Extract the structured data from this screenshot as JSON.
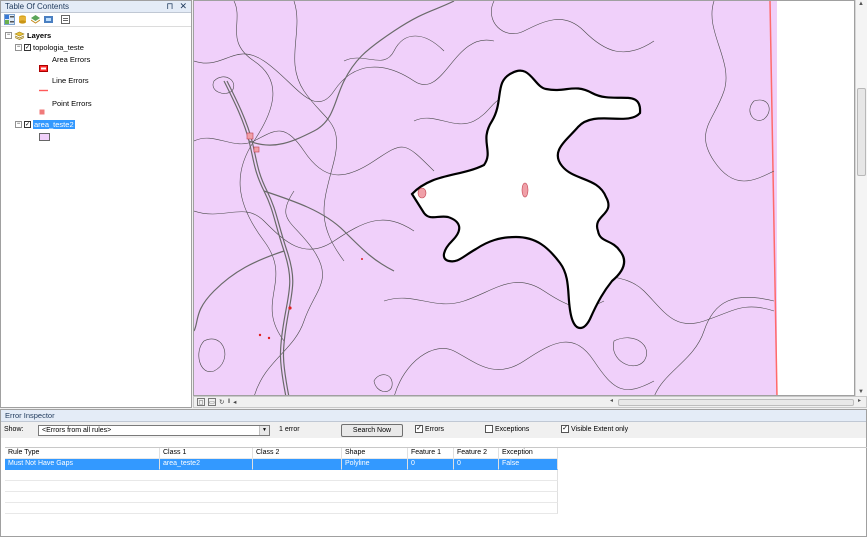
{
  "toc": {
    "title": "Table Of Contents",
    "pin": "⊓",
    "close": "✕",
    "layers_root": "Layers",
    "topology": "topologia_teste",
    "area_errors": "Area Errors",
    "line_errors": "Line Errors",
    "point_errors": "Point Errors",
    "area_layer": "area_teste2"
  },
  "error_inspector": {
    "title": "Error Inspector",
    "show_label": "Show:",
    "show_value": "<Errors from all rules>",
    "count_text": "1 error",
    "search_button": "Search Now",
    "errors_label": "Errors",
    "exceptions_label": "Exceptions",
    "visible_extent_label": "Visible Extent only",
    "columns": [
      "Rule Type",
      "Class 1",
      "Class 2",
      "Shape",
      "Feature 1",
      "Feature 2",
      "Exception"
    ],
    "rows": [
      [
        "Must Not Have Gaps",
        "area_teste2",
        "",
        "Polyline",
        "0",
        "0",
        "False"
      ]
    ]
  },
  "colors": {
    "polygon_fill": "#f0d0fa",
    "error_red": "#ff6a6a",
    "selection": "#3399ff"
  }
}
